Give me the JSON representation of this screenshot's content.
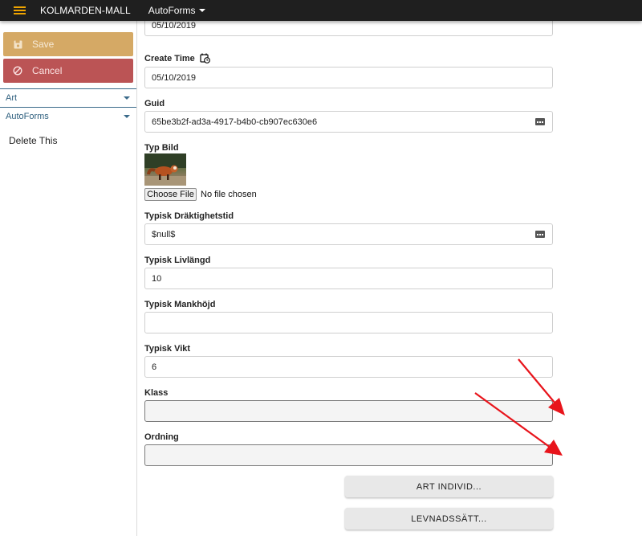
{
  "topbar": {
    "menu_icon": "hamburger-icon",
    "brand": "KOLMARDEN-MALL",
    "menu_label": "AutoForms"
  },
  "sidebar": {
    "save_label": "Save",
    "save_icon": "floppy-disk-icon",
    "cancel_label": "Cancel",
    "cancel_icon": "block-icon",
    "sections": [
      {
        "label": "Art"
      },
      {
        "label": "AutoForms"
      }
    ],
    "item": "Delete This"
  },
  "form": {
    "partial_field_value": "05/10/2019",
    "create_time": {
      "label": "Create Time",
      "icon": "calendar-clock-icon",
      "value": "05/10/2019"
    },
    "guid": {
      "label": "Guid",
      "value": "65be3b2f-ad3a-4917-b4b0-cb907ec630e6",
      "icon": "ellipsis-icon"
    },
    "typ_bild": {
      "label": "Typ Bild",
      "choose_label": "Choose File",
      "status": "No file chosen"
    },
    "draktighetstid": {
      "label": "Typisk Dräktighetstid",
      "value": "$null$",
      "icon": "ellipsis-icon"
    },
    "livlangd": {
      "label": "Typisk Livlängd",
      "value": "10"
    },
    "mankhojd": {
      "label": "Typisk Mankhöjd",
      "value": ""
    },
    "vikt": {
      "label": "Typisk Vikt",
      "value": "6"
    },
    "klass": {
      "label": "Klass",
      "value": ""
    },
    "ordning": {
      "label": "Ordning",
      "value": ""
    }
  },
  "actions": {
    "art_individ": "ART INDIVID...",
    "levnadssatt": "LEVNADSSÄTT..."
  },
  "colors": {
    "topbar": "#1f1f1f",
    "accent": "#f0a500",
    "save": "#d5a965",
    "cancel": "#bb5455",
    "annotation_arrow": "#e8141b"
  }
}
